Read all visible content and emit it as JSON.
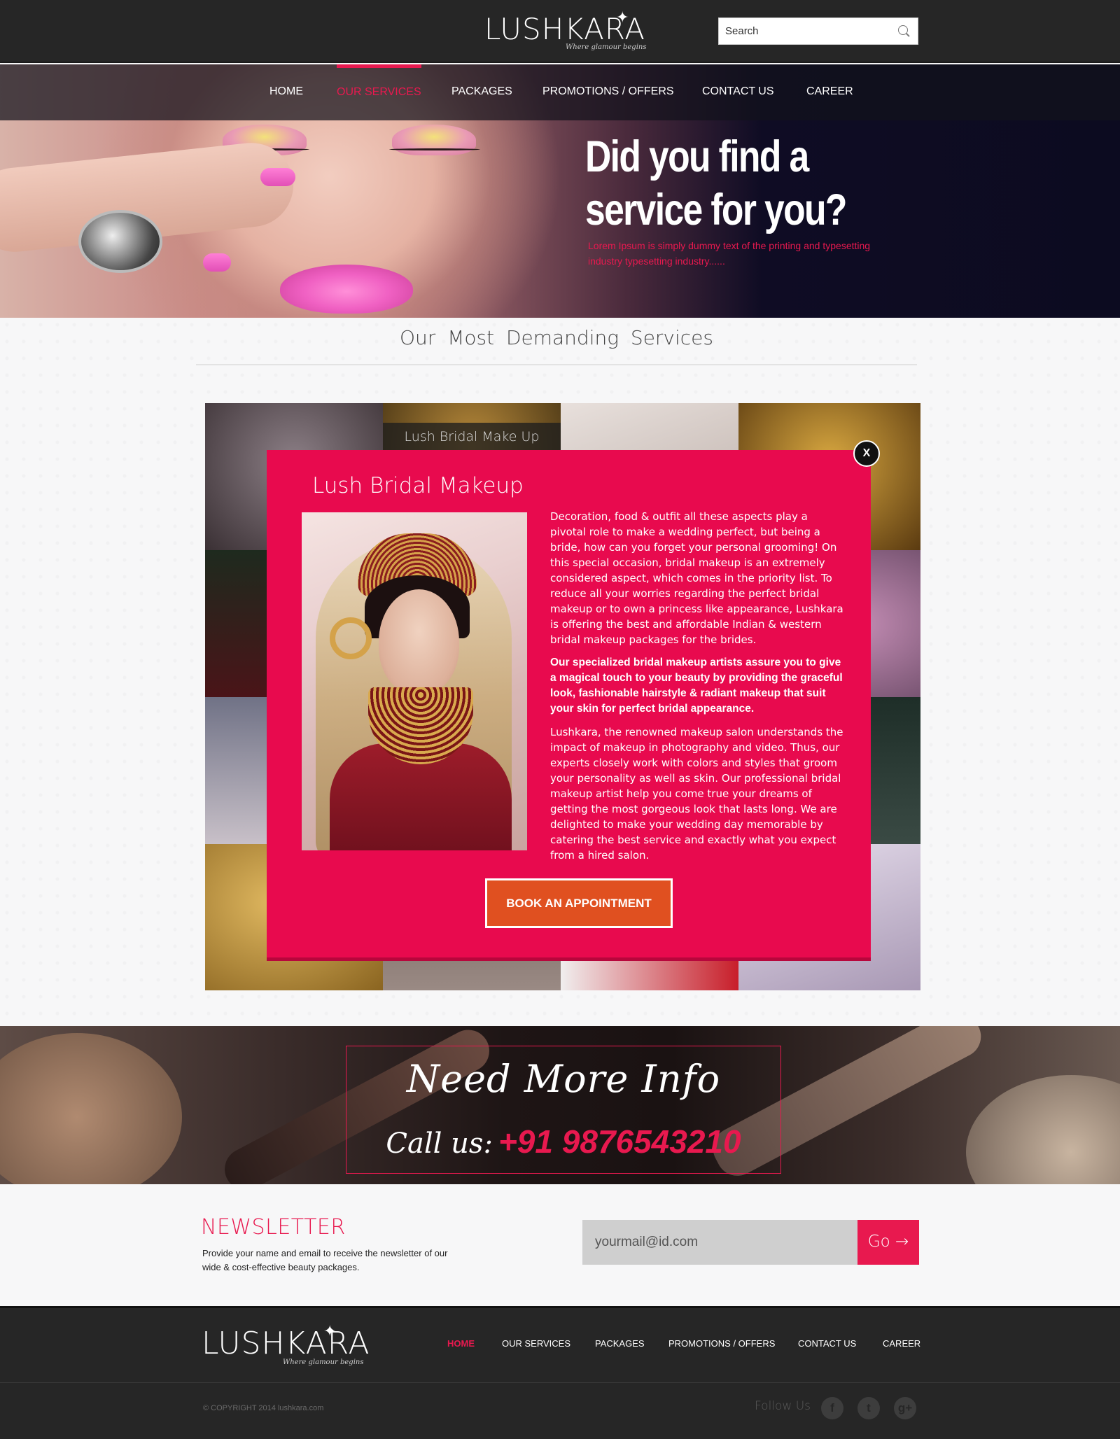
{
  "brand": {
    "name": "LUSHKARA",
    "tagline": "Where glamour begins"
  },
  "search": {
    "placeholder": "Search",
    "icon": "search-icon"
  },
  "nav": {
    "items": [
      {
        "label": "HOME",
        "active": false
      },
      {
        "label": "OUR SERVICES",
        "active": true
      },
      {
        "label": "PACKAGES",
        "active": false
      },
      {
        "label": "PROMOTIONS / OFFERS",
        "active": false
      },
      {
        "label": "CONTACT US",
        "active": false
      },
      {
        "label": "CAREER",
        "active": false
      }
    ]
  },
  "hero": {
    "title": "Did you find a service for you?",
    "subtitle": "Lorem Ipsum is simply dummy text of the printing and typesetting industry typesetting industry......"
  },
  "services": {
    "title": "Our Most Demanding Services",
    "tile_caption": "Lush Bridal Make Up"
  },
  "modal": {
    "close_label": "X",
    "title": "Lush Bridal Makeup",
    "paragraphs": [
      "Decoration, food & outfit all these aspects play a pivotal role to make a wedding perfect, but being a bride, how can you forget your personal grooming! On this special occasion, bridal makeup is an extremely considered aspect, which comes in the priority list. To reduce all your worries regarding the perfect bridal makeup or to own a princess like appearance, Lushkara is offering the best and affordable Indian & western bridal makeup packages for the brides.",
      "Our specialized bridal makeup artists assure you to give a magical touch to your beauty by providing the graceful look, fashionable hairstyle & radiant makeup that suit your skin for perfect bridal appearance.",
      "Lushkara, the renowned makeup salon understands the impact of makeup in photography and video. Thus, our experts closely work with colors and styles that groom your personality as well as skin. Our professional bridal makeup artist help you come true your dreams of getting the most gorgeous look that lasts long. We are delighted to make your wedding day memorable by catering the best service and exactly what you expect from a hired salon."
    ],
    "button_label": "BOOK AN APPOINTMENT"
  },
  "info": {
    "title": "Need More Info",
    "call_label": "Call us:",
    "phone": "+91 9876543210"
  },
  "newsletter": {
    "title": "NEWSLETTER",
    "description": "Provide your name and email to receive the newsletter of our wide & cost-effective beauty packages.",
    "placeholder": "yourmail@id.com",
    "go_label": "Go →"
  },
  "footer": {
    "nav": [
      {
        "label": "HOME",
        "active": true
      },
      {
        "label": "OUR SERVICES",
        "active": false
      },
      {
        "label": "PACKAGES",
        "active": false
      },
      {
        "label": "PROMOTIONS / OFFERS",
        "active": false
      },
      {
        "label": "CONTACT US",
        "active": false
      },
      {
        "label": "CAREER",
        "active": false
      }
    ],
    "copyright": "© COPYRIGHT 2014  lushkara.com",
    "follow_label": "Follow Us",
    "social": [
      {
        "icon": "facebook-icon",
        "glyph": "f"
      },
      {
        "icon": "twitter-icon",
        "glyph": "t"
      },
      {
        "icon": "google-plus-icon",
        "glyph": "g+"
      }
    ]
  },
  "colors": {
    "accent": "#e8194f",
    "modal_bg": "#e80a4e",
    "button_bg": "#e05020",
    "dark_bar": "#262626"
  }
}
